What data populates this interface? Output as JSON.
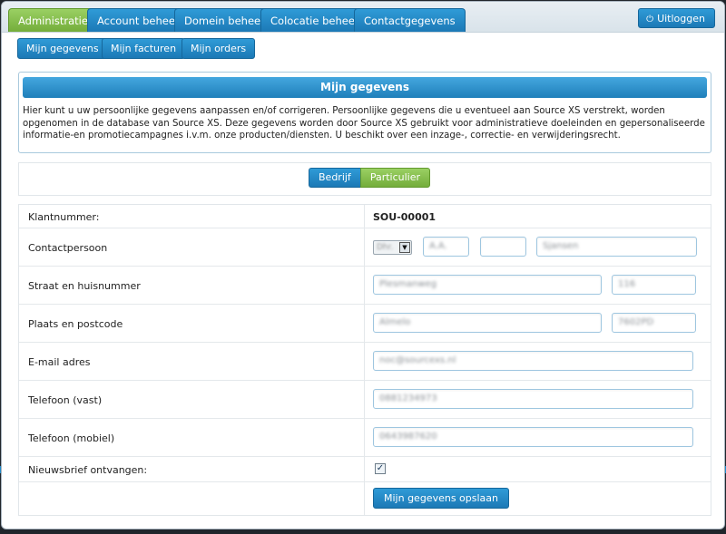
{
  "topnav": {
    "tabs": [
      {
        "label": "Administratie",
        "active": true
      },
      {
        "label": "Account beheer",
        "active": false
      },
      {
        "label": "Domein beheer",
        "active": false
      },
      {
        "label": "Colocatie beheer",
        "active": false
      },
      {
        "label": "Contactgegevens",
        "active": false
      }
    ],
    "logout_label": "Uitloggen",
    "logout_icon": "power-icon"
  },
  "subnav": {
    "items": [
      "Mijn gegevens",
      "Mijn facturen",
      "Mijn orders"
    ]
  },
  "info": {
    "title": "Mijn gegevens",
    "text": "Hier kunt u uw persoonlijke gegevens aanpassen en/of corrigeren. Persoonlijke gegevens die u eventueel aan Source XS verstrekt, worden opgenomen in de database van Source XS. Deze gegevens worden door Source XS gebruikt voor administratieve doeleinden en gepersonaliseerde informatie-en promotiecampagnes i.v.m. onze producten/diensten. U beschikt over een inzage-, correctie- en verwijderingsrecht."
  },
  "toggle": {
    "company_label": "Bedrijf",
    "private_label": "Particulier",
    "selected": "Particulier"
  },
  "form": {
    "customer_number_label": "Klantnummer:",
    "customer_number_value": "SOU-00001",
    "contact_label": "Contactpersoon",
    "contact_salutation": "Dhr.",
    "contact_initials": "A.A.",
    "contact_infix": "",
    "contact_lastname": "Sjansen",
    "street_label": "Straat en huisnummer",
    "street_value": "Plesmanweg",
    "housenumber_value": "116",
    "city_label": "Plaats en postcode",
    "city_value": "Almelo",
    "postcode_value": "7602PD",
    "email_label": "E-mail adres",
    "email_value": "noc@sourcexs.nl",
    "phone_label": "Telefoon (vast)",
    "phone_value": "0881234973",
    "mobile_label": "Telefoon (mobiel)",
    "mobile_value": "0643987620",
    "newsletter_label": "Nieuwsbrief ontvangen:",
    "newsletter_checked": true,
    "save_label": "Mijn gegevens opslaan"
  },
  "colors": {
    "tab_blue": "#1f82bf",
    "tab_active_green": "#82b945",
    "info_header": "#2c8dcc"
  }
}
